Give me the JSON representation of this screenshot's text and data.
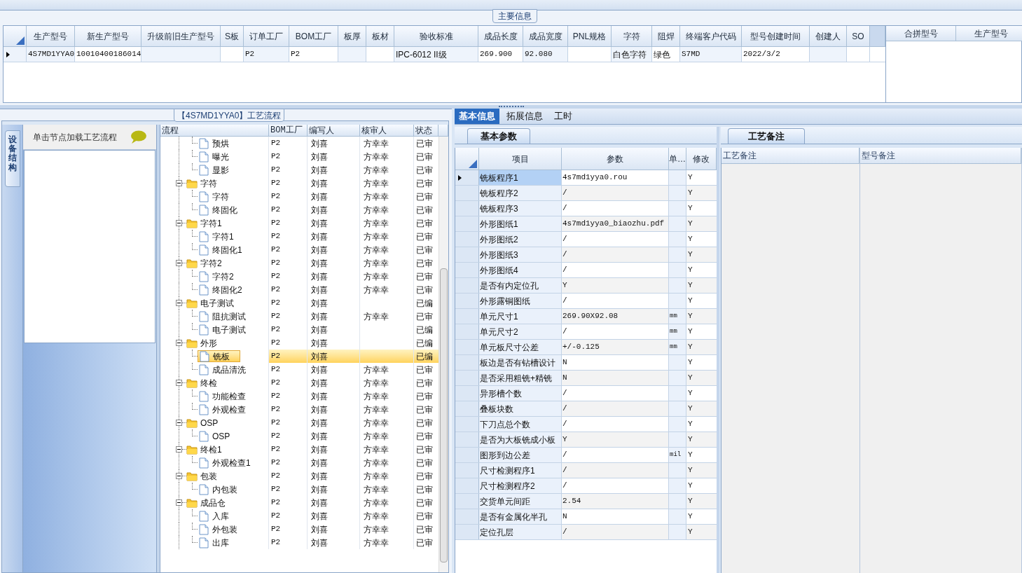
{
  "main_info": {
    "title": "主要信息",
    "table": {
      "columns": [
        "生产型号",
        "新生产型号",
        "升级前旧生产型号",
        "S板",
        "订单工厂",
        "BOM工厂",
        "板厚",
        "板材",
        "验收标准",
        "成品长度",
        "成品宽度",
        "PNL规格",
        "字符",
        "阻焊",
        "终端客户代码",
        "型号创建时间",
        "创建人",
        "SO"
      ],
      "rows": [
        {
          "selected": true,
          "cells": [
            "4S7MD1YYA0",
            "10010400186014",
            null,
            null,
            "P2",
            "P2",
            null,
            null,
            "IPC-6012 II级",
            "269.900",
            "92.080",
            null,
            "白色字符",
            "绿色",
            "S7MD",
            "2022/3/2",
            null,
            null
          ]
        }
      ]
    }
  },
  "merge_panel": {
    "columns": [
      "合拼型号",
      "生产型号"
    ]
  },
  "process": {
    "title": "【4S7MD1YYA0】工艺流程",
    "side_tab": "设备结构",
    "hint": "单击节点加载工艺流程",
    "tree": {
      "columns": [
        "流程",
        "BOM工厂",
        "编写人",
        "核审人",
        "状态"
      ],
      "nodes": [
        {
          "kind": "step",
          "label": "预烘",
          "bom": "P2",
          "author": "刘喜",
          "reviewer": "方幸幸",
          "status": "已审",
          "selected": false
        },
        {
          "kind": "step",
          "label": "曝光",
          "bom": "P2",
          "author": "刘喜",
          "reviewer": "方幸幸",
          "status": "已审",
          "selected": false
        },
        {
          "kind": "step",
          "label": "显影",
          "bom": "P2",
          "author": "刘喜",
          "reviewer": "方幸幸",
          "status": "已审",
          "selected": false
        },
        {
          "kind": "group",
          "label": "字符",
          "bom": "P2",
          "author": "刘喜",
          "reviewer": "方幸幸",
          "status": "已审",
          "selected": false,
          "expanded": true,
          "children": [
            {
              "kind": "step",
              "label": "字符",
              "bom": "P2",
              "author": "刘喜",
              "reviewer": "方幸幸",
              "status": "已审",
              "selected": false
            },
            {
              "kind": "step",
              "label": "终固化",
              "bom": "P2",
              "author": "刘喜",
              "reviewer": "方幸幸",
              "status": "已审",
              "selected": false
            }
          ]
        },
        {
          "kind": "group",
          "label": "字符1",
          "bom": "P2",
          "author": "刘喜",
          "reviewer": "方幸幸",
          "status": "已审",
          "selected": false,
          "expanded": true,
          "children": [
            {
              "kind": "step",
              "label": "字符1",
              "bom": "P2",
              "author": "刘喜",
              "reviewer": "方幸幸",
              "status": "已审",
              "selected": false
            },
            {
              "kind": "step",
              "label": "终固化1",
              "bom": "P2",
              "author": "刘喜",
              "reviewer": "方幸幸",
              "status": "已审",
              "selected": false
            }
          ]
        },
        {
          "kind": "group",
          "label": "字符2",
          "bom": "P2",
          "author": "刘喜",
          "reviewer": "方幸幸",
          "status": "已审",
          "selected": false,
          "expanded": true,
          "children": [
            {
              "kind": "step",
              "label": "字符2",
              "bom": "P2",
              "author": "刘喜",
              "reviewer": "方幸幸",
              "status": "已审",
              "selected": false
            },
            {
              "kind": "step",
              "label": "终固化2",
              "bom": "P2",
              "author": "刘喜",
              "reviewer": "方幸幸",
              "status": "已审",
              "selected": false
            }
          ]
        },
        {
          "kind": "group",
          "label": "电子测试",
          "bom": "P2",
          "author": "刘喜",
          "status": "已编",
          "selected": false,
          "expanded": true,
          "children": [
            {
              "kind": "step",
              "label": "阻抗测试",
              "bom": "P2",
              "author": "刘喜",
              "reviewer": "方幸幸",
              "status": "已审",
              "selected": false
            },
            {
              "kind": "step",
              "label": "电子测试",
              "bom": "P2",
              "author": "刘喜",
              "status": "已编",
              "selected": false
            }
          ]
        },
        {
          "kind": "group",
          "label": "外形",
          "bom": "P2",
          "author": "刘喜",
          "status": "已编",
          "selected": false,
          "expanded": true,
          "children": [
            {
              "kind": "step",
              "label": "铣板",
              "bom": "P2",
              "author": "刘喜",
              "status": "已编",
              "selected": true
            },
            {
              "kind": "step",
              "label": "成品清洗",
              "bom": "P2",
              "author": "刘喜",
              "reviewer": "方幸幸",
              "status": "已审",
              "selected": false
            }
          ]
        },
        {
          "kind": "group",
          "label": "终检",
          "bom": "P2",
          "author": "刘喜",
          "reviewer": "方幸幸",
          "status": "已审",
          "selected": false,
          "expanded": true,
          "children": [
            {
              "kind": "step",
              "label": "功能检查",
              "bom": "P2",
              "author": "刘喜",
              "reviewer": "方幸幸",
              "status": "已审",
              "selected": false
            },
            {
              "kind": "step",
              "label": "外观检查",
              "bom": "P2",
              "author": "刘喜",
              "reviewer": "方幸幸",
              "status": "已审",
              "selected": false
            }
          ]
        },
        {
          "kind": "group",
          "label": "OSP",
          "bom": "P2",
          "author": "刘喜",
          "reviewer": "方幸幸",
          "status": "已审",
          "selected": false,
          "expanded": true,
          "children": [
            {
              "kind": "step",
              "label": "OSP",
              "bom": "P2",
              "author": "刘喜",
              "reviewer": "方幸幸",
              "status": "已审",
              "selected": false
            }
          ]
        },
        {
          "kind": "group",
          "label": "终检1",
          "bom": "P2",
          "author": "刘喜",
          "reviewer": "方幸幸",
          "status": "已审",
          "selected": false,
          "expanded": true,
          "children": [
            {
              "kind": "step",
              "label": "外观检查1",
              "bom": "P2",
              "author": "刘喜",
              "reviewer": "方幸幸",
              "status": "已审",
              "selected": false
            }
          ]
        },
        {
          "kind": "group",
          "label": "包装",
          "bom": "P2",
          "author": "刘喜",
          "reviewer": "方幸幸",
          "status": "已审",
          "selected": false,
          "expanded": true,
          "children": [
            {
              "kind": "step",
              "label": "内包装",
              "bom": "P2",
              "author": "刘喜",
              "reviewer": "方幸幸",
              "status": "已审",
              "selected": false
            }
          ]
        },
        {
          "kind": "group",
          "label": "成品仓",
          "bom": "P2",
          "author": "刘喜",
          "reviewer": "方幸幸",
          "status": "已审",
          "selected": false,
          "expanded": true,
          "children": [
            {
              "kind": "step",
              "label": "入库",
              "bom": "P2",
              "author": "刘喜",
              "reviewer": "方幸幸",
              "status": "已审",
              "selected": false
            },
            {
              "kind": "step",
              "label": "外包装",
              "bom": "P2",
              "author": "刘喜",
              "reviewer": "方幸幸",
              "status": "已审",
              "selected": false
            },
            {
              "kind": "step",
              "label": "出库",
              "bom": "P2",
              "author": "刘喜",
              "reviewer": "方幸幸",
              "status": "已审",
              "selected": false
            }
          ]
        }
      ]
    }
  },
  "detail_tabs": [
    {
      "label": "基本信息",
      "selected": true
    },
    {
      "label": "拓展信息",
      "selected": false
    },
    {
      "label": "工时",
      "selected": false
    }
  ],
  "basic_params": {
    "tab": "基本参数",
    "columns": [
      "项目",
      "参数",
      "单…",
      "修改"
    ],
    "rows": [
      {
        "item": "铣板程序1",
        "value": "4s7md1yya0.rou",
        "modified": "Y",
        "selected": true
      },
      {
        "item": "铣板程序2",
        "value": "/",
        "modified": "Y",
        "selected": false
      },
      {
        "item": "铣板程序3",
        "value": "/",
        "modified": "Y",
        "selected": false
      },
      {
        "item": "外形图纸1",
        "value": "4s7md1yya0_biaozhu.pdf",
        "modified": "Y",
        "selected": false
      },
      {
        "item": "外形图纸2",
        "value": "/",
        "modified": "Y",
        "selected": false
      },
      {
        "item": "外形图纸3",
        "value": "/",
        "modified": "Y",
        "selected": false
      },
      {
        "item": "外形图纸4",
        "value": "/",
        "modified": "Y",
        "selected": false
      },
      {
        "item": "是否有内定位孔",
        "value": "Y",
        "modified": "Y",
        "selected": false
      },
      {
        "item": "外形露铜图纸",
        "value": "/",
        "modified": "Y",
        "selected": false
      },
      {
        "item": "单元尺寸1",
        "value": "269.90X92.08",
        "unit": "mm",
        "modified": "Y",
        "selected": false
      },
      {
        "item": "单元尺寸2",
        "value": "/",
        "unit": "mm",
        "modified": "Y",
        "selected": false
      },
      {
        "item": "单元板尺寸公差",
        "value": "+/-0.125",
        "unit": "mm",
        "modified": "Y",
        "selected": false
      },
      {
        "item": "板边是否有钻槽设计",
        "value": "N",
        "modified": "Y",
        "selected": false
      },
      {
        "item": "是否采用粗铣+精铣",
        "value": "N",
        "modified": "Y",
        "selected": false
      },
      {
        "item": "异形槽个数",
        "value": "/",
        "modified": "Y",
        "selected": false
      },
      {
        "item": "叠板块数",
        "value": "/",
        "modified": "Y",
        "selected": false
      },
      {
        "item": "下刀点总个数",
        "value": "/",
        "modified": "Y",
        "selected": false
      },
      {
        "item": "是否为大板铣成小板",
        "value": "Y",
        "modified": "Y",
        "selected": false
      },
      {
        "item": "图形到边公差",
        "value": "/",
        "unit": "mil",
        "modified": "Y",
        "selected": false
      },
      {
        "item": "尺寸检测程序1",
        "value": "/",
        "modified": "Y",
        "selected": false
      },
      {
        "item": "尺寸检测程序2",
        "value": "/",
        "modified": "Y",
        "selected": false
      },
      {
        "item": "交货单元间距",
        "value": "2.54",
        "modified": "Y",
        "selected": false
      },
      {
        "item": "是否有金属化半孔",
        "value": "N",
        "modified": "Y",
        "selected": false
      },
      {
        "item": "定位孔层",
        "value": "/",
        "modified": "Y",
        "selected": false
      }
    ]
  },
  "notes": {
    "tab": "工艺备注",
    "columns": [
      "工艺备注",
      "型号备注"
    ]
  }
}
